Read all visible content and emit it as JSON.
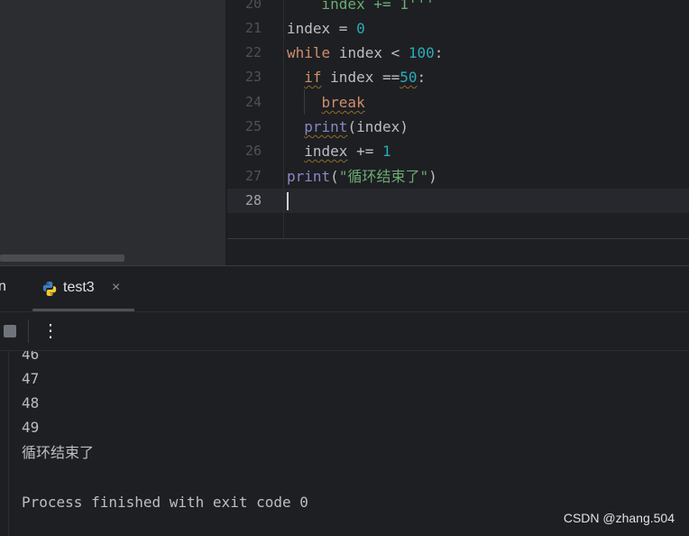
{
  "editor": {
    "lines": [
      {
        "no": "20",
        "text": "    index += 1'''"
      },
      {
        "no": "21",
        "text": "index = 0"
      },
      {
        "no": "22",
        "text": "while index < 100:"
      },
      {
        "no": "23",
        "text": "  if index ==50:"
      },
      {
        "no": "24",
        "text": "    break"
      },
      {
        "no": "25",
        "text": "  print(index)"
      },
      {
        "no": "26",
        "text": "  index += 1"
      },
      {
        "no": "27",
        "text": "print(\"循环结束了\")"
      },
      {
        "no": "28",
        "text": ""
      }
    ],
    "tokens": {
      "l20": "    index += 1'''",
      "index": "index",
      "assign": " = ",
      "zero": "0",
      "while": "while",
      "lt": " < ",
      "hundred": "100",
      "colon": ":",
      "if": "if",
      "eqeq": " ==",
      "fifty": "50",
      "break": "break",
      "print": "print",
      "paren_index": "(index)",
      "pluseq": " += ",
      "one": "1",
      "paren_open": "(",
      "string": "\"循环结束了\"",
      "paren_close": ")"
    }
  },
  "run_panel": {
    "partial_tab_label": "n",
    "tab_label": "test3",
    "tab_close": "×",
    "more_label": "⋮"
  },
  "console": {
    "lines": [
      "46",
      "47",
      "48",
      "49",
      "循环结束了",
      "",
      "Process finished with exit code 0"
    ]
  },
  "watermark": "CSDN @zhang.504",
  "icons": {
    "tab": "python-icon",
    "stop": "stop-icon",
    "more": "more-vertical-icon",
    "close": "close-icon"
  },
  "colors": {
    "keyword": "#cf8e6d",
    "number": "#2aacb8",
    "builtin": "#8888c6",
    "string": "#6aab73",
    "background": "#1e1f22"
  }
}
